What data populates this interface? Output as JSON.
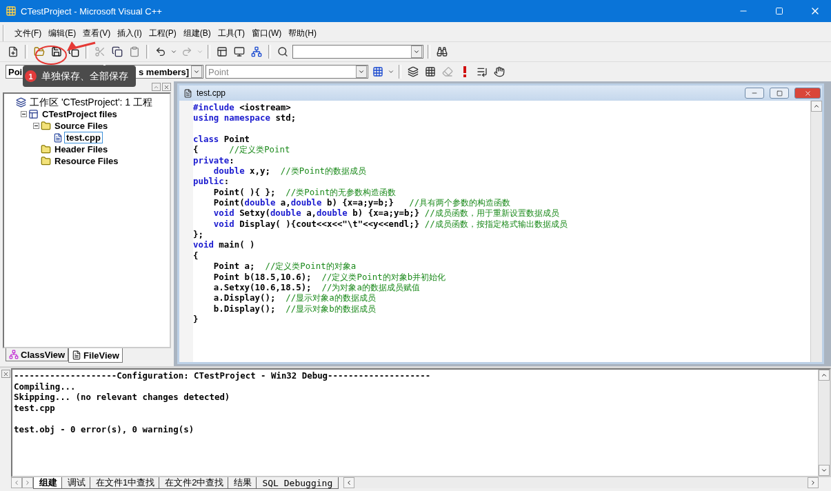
{
  "window": {
    "title": "CTestProject - Microsoft Visual C++"
  },
  "menu": [
    "文件(F)",
    "编辑(E)",
    "查看(V)",
    "插入(I)",
    "工程(P)",
    "组建(B)",
    "工具(T)",
    "窗口(W)",
    "帮助(H)"
  ],
  "wizard_bar": {
    "class_combo": "Poi",
    "members_combo": "s members]",
    "function_combo": "Point"
  },
  "annotation": {
    "badge": "1",
    "text": "单独保存、全部保存"
  },
  "workspace": {
    "tree": [
      {
        "label": "工作区 'CTestProject': 1 工程",
        "kind": "workspace",
        "selected": false,
        "children": [
          {
            "label": "CTestProject files",
            "kind": "project",
            "selected": false,
            "expanded": true,
            "children": [
              {
                "label": "Source Files",
                "kind": "folder",
                "selected": false,
                "expanded": true,
                "children": [
                  {
                    "label": "test.cpp",
                    "kind": "file",
                    "selected": true
                  }
                ]
              },
              {
                "label": "Header Files",
                "kind": "folder",
                "selected": false
              },
              {
                "label": "Resource Files",
                "kind": "folder",
                "selected": false
              }
            ]
          }
        ]
      }
    ],
    "tabs": [
      {
        "label": "ClassView",
        "kind": "class",
        "selected": false
      },
      {
        "label": "FileView",
        "kind": "file",
        "selected": true
      }
    ]
  },
  "editor": {
    "title": "test.cpp",
    "lines": [
      {
        "kind": "code",
        "segments": [
          {
            "kind": "kw",
            "text": "#include"
          },
          {
            "kind": "plain",
            "text": " <iostream>"
          }
        ]
      },
      {
        "kind": "code",
        "segments": [
          {
            "kind": "kw",
            "text": "using"
          },
          {
            "kind": "kw",
            "text": " namespace"
          },
          {
            "kind": "plain",
            "text": " std;"
          }
        ]
      },
      {
        "kind": "blank"
      },
      {
        "kind": "code",
        "segments": [
          {
            "kind": "kw",
            "text": "class"
          },
          {
            "kind": "plain",
            "text": " Point"
          }
        ]
      },
      {
        "kind": "code",
        "segments": [
          {
            "kind": "plain",
            "text": "{      "
          },
          {
            "kind": "comment",
            "text": "//定义类Point"
          }
        ]
      },
      {
        "kind": "code",
        "segments": [
          {
            "kind": "kw",
            "text": "private"
          },
          {
            "kind": "plain",
            "text": ":"
          }
        ]
      },
      {
        "kind": "code",
        "segments": [
          {
            "kind": "kw",
            "text": "    double"
          },
          {
            "kind": "plain",
            "text": " x,y;  "
          },
          {
            "kind": "comment",
            "text": "//类Point的数据成员"
          }
        ]
      },
      {
        "kind": "code",
        "segments": [
          {
            "kind": "kw",
            "text": "public"
          },
          {
            "kind": "plain",
            "text": ":"
          }
        ]
      },
      {
        "kind": "code",
        "segments": [
          {
            "kind": "plain",
            "text": "    Point( ){ };  "
          },
          {
            "kind": "comment",
            "text": "//类Point的无参数构造函数"
          }
        ]
      },
      {
        "kind": "code",
        "segments": [
          {
            "kind": "plain",
            "text": "    Point("
          },
          {
            "kind": "kw",
            "text": "double"
          },
          {
            "kind": "plain",
            "text": " a,"
          },
          {
            "kind": "kw",
            "text": "double"
          },
          {
            "kind": "plain",
            "text": " b) {x=a;y=b;}   "
          },
          {
            "kind": "comment",
            "text": "//具有两个参数的构造函数"
          }
        ]
      },
      {
        "kind": "code",
        "segments": [
          {
            "kind": "kw",
            "text": "    void"
          },
          {
            "kind": "plain",
            "text": " Setxy("
          },
          {
            "kind": "kw",
            "text": "double"
          },
          {
            "kind": "plain",
            "text": " a,"
          },
          {
            "kind": "kw",
            "text": "double"
          },
          {
            "kind": "plain",
            "text": " b) {x=a;y=b;} "
          },
          {
            "kind": "comment",
            "text": "//成员函数，用于重新设置数据成员"
          }
        ]
      },
      {
        "kind": "code",
        "segments": [
          {
            "kind": "kw",
            "text": "    void"
          },
          {
            "kind": "plain",
            "text": " Display( ){cout<<x<<\"\\t\"<<y<<endl;} "
          },
          {
            "kind": "comment",
            "text": "//成员函数，按指定格式输出数据成员"
          }
        ]
      },
      {
        "kind": "code",
        "segments": [
          {
            "kind": "plain",
            "text": "};"
          }
        ]
      },
      {
        "kind": "code",
        "segments": [
          {
            "kind": "kw",
            "text": "void"
          },
          {
            "kind": "plain",
            "text": " main( )"
          }
        ]
      },
      {
        "kind": "code",
        "segments": [
          {
            "kind": "plain",
            "text": "{"
          }
        ]
      },
      {
        "kind": "code",
        "segments": [
          {
            "kind": "plain",
            "text": "    Point a;  "
          },
          {
            "kind": "comment",
            "text": "//定义类Point的对象a"
          }
        ]
      },
      {
        "kind": "code",
        "segments": [
          {
            "kind": "plain",
            "text": "    Point b(18.5,10.6);  "
          },
          {
            "kind": "comment",
            "text": "//定义类Point的对象b并初始化"
          }
        ]
      },
      {
        "kind": "code",
        "segments": [
          {
            "kind": "plain",
            "text": "    a.Setxy(10.6,18.5);  "
          },
          {
            "kind": "comment",
            "text": "//为对象a的数据成员赋值"
          }
        ]
      },
      {
        "kind": "code",
        "segments": [
          {
            "kind": "plain",
            "text": "    a.Display();  "
          },
          {
            "kind": "comment",
            "text": "//显示对象a的数据成员"
          }
        ]
      },
      {
        "kind": "code",
        "segments": [
          {
            "kind": "plain",
            "text": "    b.Display();  "
          },
          {
            "kind": "comment",
            "text": "//显示对象b的数据成员"
          }
        ]
      },
      {
        "kind": "code",
        "segments": [
          {
            "kind": "plain",
            "text": "}"
          }
        ]
      }
    ]
  },
  "output": {
    "lines": [
      {
        "kind": "text",
        "text": "--------------------Configuration: CTestProject - Win32 Debug--------------------"
      },
      {
        "kind": "text",
        "text": "Compiling..."
      },
      {
        "kind": "text",
        "text": "Skipping... (no relevant changes detected)"
      },
      {
        "kind": "text",
        "text": "test.cpp"
      },
      {
        "kind": "blank"
      },
      {
        "kind": "text",
        "text": "test.obj - 0 error(s), 0 warning(s)"
      }
    ],
    "tabs": [
      {
        "label": "组建",
        "selected": true
      },
      {
        "label": "调试",
        "selected": false
      },
      {
        "label": "在文件1中查找",
        "selected": false
      },
      {
        "label": "在文件2中查找",
        "selected": false
      },
      {
        "label": "结果",
        "selected": false
      },
      {
        "label": "SQL Debugging",
        "selected": false
      }
    ]
  }
}
